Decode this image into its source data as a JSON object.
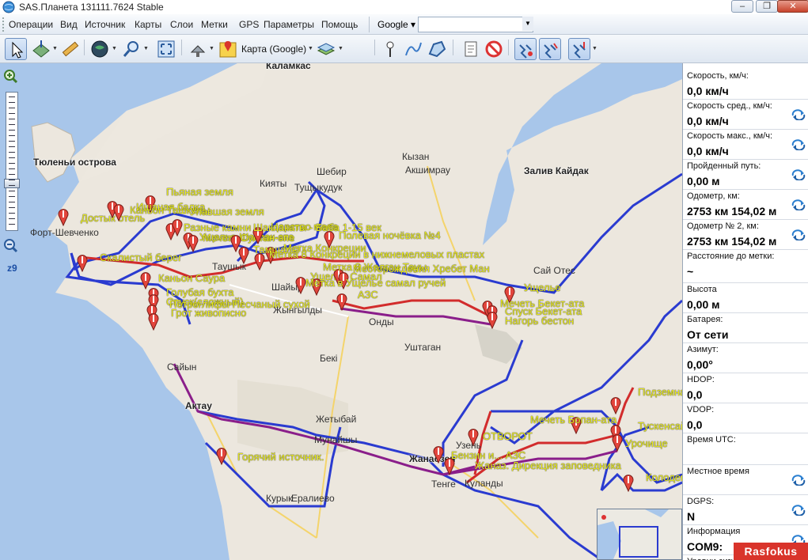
{
  "window": {
    "title": "SAS.Планета 131111.7624 Stable",
    "minimize": "‒",
    "maximize": "❐",
    "close": "✕"
  },
  "menu": {
    "items": [
      "Операции",
      "Вид",
      "Источник",
      "Карты",
      "Слои",
      "Метки",
      "GPS",
      "Параметры",
      "Помощь"
    ],
    "search_source": "Google ▾",
    "search_value": ""
  },
  "toolbar": {
    "map_source_label": "Карта (Google)"
  },
  "zoom": {
    "level": "z9"
  },
  "map": {
    "places": [
      {
        "text": "Каламкас",
        "bold": true
      },
      {
        "text": "Тюленьи острова",
        "bold": true
      },
      {
        "text": "Форт-Шевченко"
      },
      {
        "text": "Кызан"
      },
      {
        "text": "Акшимрау"
      },
      {
        "text": "Шебир"
      },
      {
        "text": "Кияты"
      },
      {
        "text": "Тущыкудук"
      },
      {
        "text": "Залив Кайдак",
        "bold": true
      },
      {
        "text": "Таушык"
      },
      {
        "text": "Сай Отес"
      },
      {
        "text": "Шайыр"
      },
      {
        "text": "Жынгылды"
      },
      {
        "text": "Онды"
      },
      {
        "text": "Бекі"
      },
      {
        "text": "Уштаган"
      },
      {
        "text": "Сайын"
      },
      {
        "text": "Актау",
        "bold": true
      },
      {
        "text": "Жетыбай"
      },
      {
        "text": "Мунайшы"
      },
      {
        "text": "Жанаозен",
        "bold": true
      },
      {
        "text": "Узень"
      },
      {
        "text": "Тенге"
      },
      {
        "text": "Куланды"
      },
      {
        "text": "Курык"
      },
      {
        "text": "Ералиево"
      }
    ],
    "markers": [
      {
        "label": "Достык отель"
      },
      {
        "label": "Каньон Ташкелы"
      },
      {
        "label": "Пьяная земля"
      },
      {
        "label": "Ишаная балка"
      },
      {
        "label": "Разные камни"
      },
      {
        "label": "Ущелье Шакпак-ата"
      },
      {
        "label": "Упавшая земля"
      },
      {
        "label": "Мечеть Султан-эпе"
      },
      {
        "label": "Царство мела"
      },
      {
        "label": "Шакпакаты - Баба 1-15 век"
      },
      {
        "label": "Метка Конкреции"
      },
      {
        "label": "Тамшалы"
      },
      {
        "label": "Ущелье Самал"
      },
      {
        "label": "Полевая ночёвка №4"
      },
      {
        "label": "Метка 8 Конкреции в нижнемеловых пластах"
      },
      {
        "label": "Метка 8 Жалган Тауы"
      },
      {
        "label": "Месторождения Хребет Ман"
      },
      {
        "label": "Метка в Ущелье самал ручей"
      },
      {
        "label": "Скалистый берег"
      },
      {
        "label": "Каньон Саура"
      },
      {
        "label": "Голубая бухта"
      },
      {
        "label": "Спуск(сложный)"
      },
      {
        "label": "Петроглифы Песчаный сухой"
      },
      {
        "label": "Грот живописно"
      },
      {
        "label": "АЗС"
      },
      {
        "label": "Ущелье"
      },
      {
        "label": "Мечеть Бекет-ата"
      },
      {
        "label": "Спуск Бекет-ата"
      },
      {
        "label": "Нагорь бестон"
      },
      {
        "label": "Горячий источник."
      },
      {
        "label": "Мечеть Бопан-ата"
      },
      {
        "label": "ОТВОРОТ"
      },
      {
        "label": "Подземная мечеть"
      },
      {
        "label": "Тускенсай"
      },
      {
        "label": "Урочище"
      },
      {
        "label": "Колодец"
      },
      {
        "label": "Бензин и... АЗС"
      },
      {
        "label": "Жаназ.  Дирекция заповедника"
      }
    ]
  },
  "panel": {
    "items": [
      {
        "label": "Скорость, км/ч:",
        "value": "0,0 км/ч",
        "refresh": false
      },
      {
        "label": "Скорость сред., км/ч:",
        "value": "0,0 км/ч",
        "refresh": true
      },
      {
        "label": "Скорость макс., км/ч:",
        "value": "0,0 км/ч",
        "refresh": true
      },
      {
        "label": "Пройденный путь:",
        "value": "0,00 м",
        "refresh": true
      },
      {
        "label": "Одометр, км:",
        "value": "2753 км 154,02 м",
        "refresh": true
      },
      {
        "label": "Одометр № 2, км:",
        "value": "2753 км 154,02 м",
        "refresh": true
      },
      {
        "label": "Расстояние до метки:",
        "value": "~",
        "refresh": false
      },
      {
        "label": "Высота",
        "value": "0,00 м",
        "refresh": false
      },
      {
        "label": "Батарея:",
        "value": "От сети",
        "refresh": false
      },
      {
        "label": "Азимут:",
        "value": "0,00°",
        "refresh": false
      },
      {
        "label": "HDOP:",
        "value": "0,0",
        "refresh": false
      },
      {
        "label": "VDOP:",
        "value": "0,0",
        "refresh": false
      },
      {
        "label": "Время UTC:",
        "value": "",
        "refresh": false
      },
      {
        "label": "Местное время",
        "value": "",
        "refresh": true
      },
      {
        "label": "DGPS:",
        "value": "N",
        "refresh": true
      },
      {
        "label": "Информация",
        "value": "COM9:",
        "refresh": true
      },
      {
        "label": "Уровни сигн",
        "value": "",
        "refresh": false
      }
    ]
  },
  "watermark": "Rasfokus"
}
